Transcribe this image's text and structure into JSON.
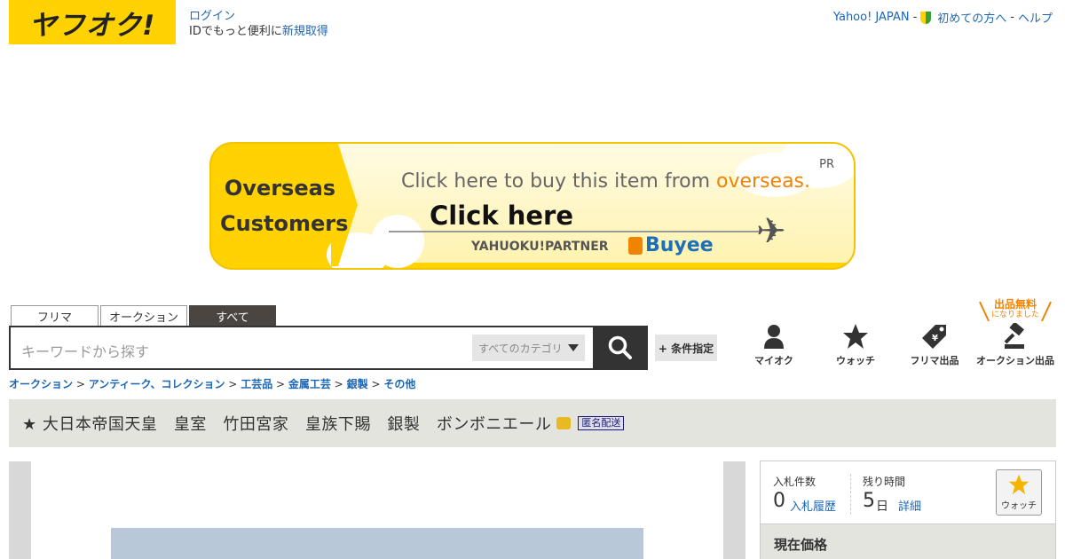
{
  "header": {
    "logo_text": "ヤフオク!",
    "login_link": "ログイン",
    "login_sub_prefix": "IDでもっと便利に",
    "register_link": "新規取得",
    "nav": {
      "yahoo_japan": "Yahoo! JAPAN",
      "sep": "-",
      "beginners": "初めての方へ",
      "help": "ヘルプ"
    }
  },
  "banner": {
    "left_line1": "Overseas",
    "left_line2": "Customers",
    "pr": "PR",
    "headline_prefix": "Click here to buy this item from ",
    "headline_accent": "overseas.",
    "cta": "Click here",
    "partner": "YAHUOKU!PARTNER",
    "brand": "Buyee",
    "accent_color": "#f08300"
  },
  "search": {
    "tabs": [
      "フリマ",
      "オークション",
      "すべて"
    ],
    "active_tab": "すべて",
    "placeholder": "キーワードから探す",
    "category_select": "すべてのカテゴリ",
    "advanced_button": "+ 条件指定"
  },
  "shortcuts": {
    "free_listing_badge": "出品無料",
    "free_listing_sub": "になりました",
    "items": [
      {
        "label": "マイオク",
        "icon": "person-icon"
      },
      {
        "label": "ウォッチ",
        "icon": "star-icon"
      },
      {
        "label": "フリマ出品",
        "icon": "price-tag-icon"
      },
      {
        "label": "オークション出品",
        "icon": "gavel-icon"
      }
    ]
  },
  "breadcrumb": {
    "items": [
      "オークション",
      "アンティーク、コレクション",
      "工芸品",
      "金属工芸",
      "銀製",
      "その他"
    ],
    "separator": ">"
  },
  "item": {
    "title": "★ 大日本帝国天皇　皇室　竹田宮家　皇族下賜　銀製　ボンボニエール",
    "anon_badge": "匿名配送"
  },
  "panel": {
    "bids_label": "入札件数",
    "bids_value": "0",
    "bids_link": "入札履歴",
    "time_label": "残り時間",
    "time_value": "5",
    "time_unit": "日",
    "time_link": "詳細",
    "watch_label": "ウォッチ",
    "price_heading": "現在価格"
  }
}
